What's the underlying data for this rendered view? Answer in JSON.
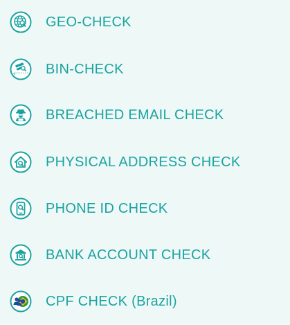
{
  "colors": {
    "accent": "#1aa3a0",
    "background": "#eef8f7",
    "flag_green": "#2e9b3c",
    "flag_yellow": "#f2c21b",
    "flag_blue": "#1f4aa0"
  },
  "checks": [
    {
      "label": "GEO-CHECK",
      "icon": "globe-search-icon"
    },
    {
      "label": "BIN-CHECK",
      "icon": "card-search-icon"
    },
    {
      "label": "BREACHED EMAIL CHECK",
      "icon": "hacker-icon"
    },
    {
      "label": "PHYSICAL ADDRESS CHECK",
      "icon": "house-search-icon"
    },
    {
      "label": "PHONE ID CHECK",
      "icon": "phone-search-icon"
    },
    {
      "label": "BANK ACCOUNT CHECK",
      "icon": "bank-icon"
    },
    {
      "label": "CPF CHECK (Brazil)",
      "icon": "brazil-users-icon"
    }
  ]
}
